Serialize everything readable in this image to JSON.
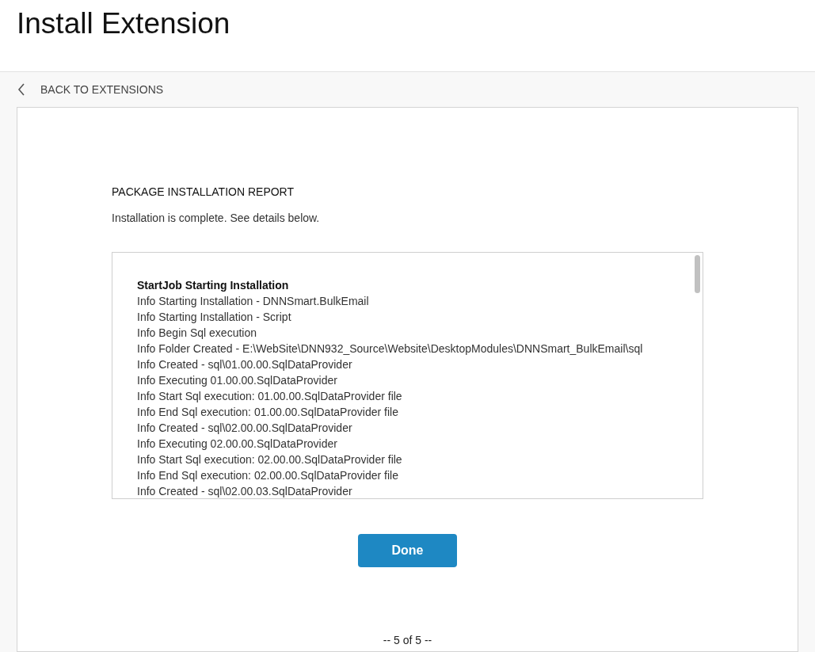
{
  "page_title": "Install Extension",
  "back_link": "BACK TO EXTENSIONS",
  "report": {
    "title": "PACKAGE INSTALLATION REPORT",
    "message": "Installation is complete. See details below.",
    "log": [
      {
        "kind": "heading",
        "text": "StartJob Starting Installation"
      },
      {
        "kind": "info",
        "text": "Info Starting Installation - DNNSmart.BulkEmail"
      },
      {
        "kind": "info",
        "text": "Info Starting Installation - Script"
      },
      {
        "kind": "info",
        "text": "Info Begin Sql execution"
      },
      {
        "kind": "info",
        "text": "Info Folder Created - E:\\WebSite\\DNN932_Source\\Website\\DesktopModules\\DNNSmart_BulkEmail\\sql"
      },
      {
        "kind": "info",
        "text": "Info Created - sql\\01.00.00.SqlDataProvider"
      },
      {
        "kind": "info",
        "text": "Info Executing 01.00.00.SqlDataProvider"
      },
      {
        "kind": "info",
        "text": "Info Start Sql execution: 01.00.00.SqlDataProvider file"
      },
      {
        "kind": "info",
        "text": "Info End Sql execution: 01.00.00.SqlDataProvider file"
      },
      {
        "kind": "info",
        "text": "Info Created - sql\\02.00.00.SqlDataProvider"
      },
      {
        "kind": "info",
        "text": "Info Executing 02.00.00.SqlDataProvider"
      },
      {
        "kind": "info",
        "text": "Info Start Sql execution: 02.00.00.SqlDataProvider file"
      },
      {
        "kind": "info",
        "text": "Info End Sql execution: 02.00.00.SqlDataProvider file"
      },
      {
        "kind": "info",
        "text": "Info Created - sql\\02.00.03.SqlDataProvider"
      }
    ],
    "done_button": "Done",
    "pager": "-- 5 of 5 --"
  }
}
